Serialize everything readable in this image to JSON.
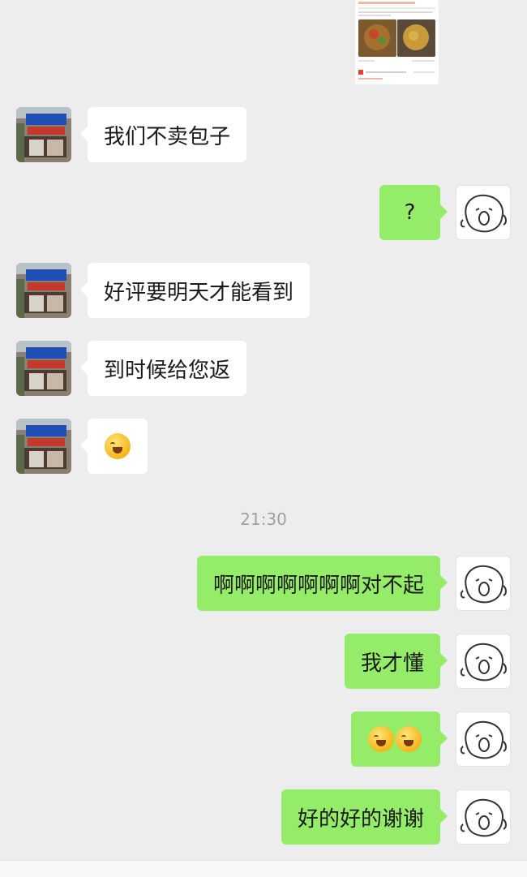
{
  "chat": {
    "timestamp": "21:30",
    "messages": [
      {
        "side": "in",
        "text": "我们不卖包子"
      },
      {
        "side": "out",
        "text": "?"
      },
      {
        "side": "in",
        "text": "好评要明天才能看到"
      },
      {
        "side": "in",
        "text": "到时候给您返"
      },
      {
        "side": "in",
        "emoji": [
          "laugh-cry-emoji"
        ]
      },
      {
        "side": "out",
        "text": "啊啊啊啊啊啊啊对不起"
      },
      {
        "side": "out",
        "text": "我才懂"
      },
      {
        "side": "out",
        "emoji": [
          "laugh-cry-emoji",
          "laugh-cry-emoji"
        ]
      },
      {
        "side": "out",
        "text": "好的好的谢谢"
      }
    ]
  },
  "colors": {
    "background": "#ededed",
    "outgoing_bubble": "#95ec69",
    "incoming_bubble": "#ffffff",
    "timestamp": "#a0a0a0"
  }
}
